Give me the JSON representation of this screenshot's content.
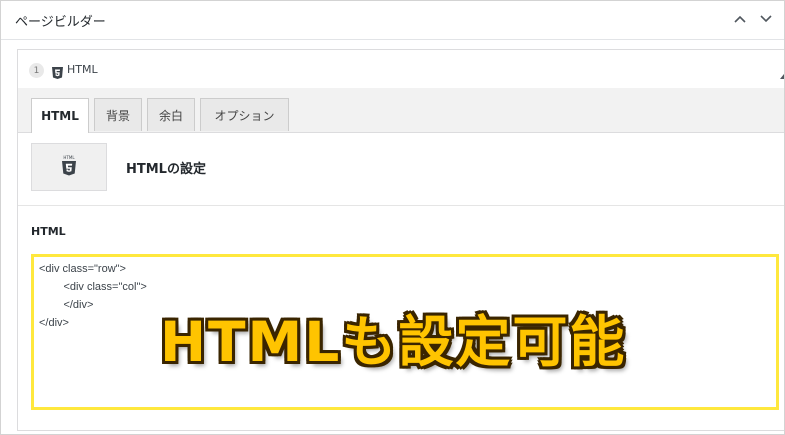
{
  "box": {
    "title": "ページビルダー",
    "controls": [
      "chevron-up-icon",
      "chevron-down-icon"
    ]
  },
  "module": {
    "index": "1",
    "icon": "html5-icon",
    "name": "HTML"
  },
  "tabs": [
    {
      "label": "HTML",
      "active": true
    },
    {
      "label": "背景",
      "active": false
    },
    {
      "label": "余白",
      "active": false
    },
    {
      "label": "オプション",
      "active": false
    }
  ],
  "settings": {
    "icon": "html5-icon",
    "label": "HTMLの設定"
  },
  "field": {
    "label": "HTML",
    "code_lines": [
      "<div class=\"row\">",
      "        <div class=\"col\">",
      "",
      "        </div>",
      "</div>"
    ]
  },
  "overlay_text": "HTMLも設定可能",
  "colors": {
    "highlight_border": "#ffe83d",
    "overlay_fill": "#ffc400",
    "overlay_outline": "#3a2500"
  }
}
